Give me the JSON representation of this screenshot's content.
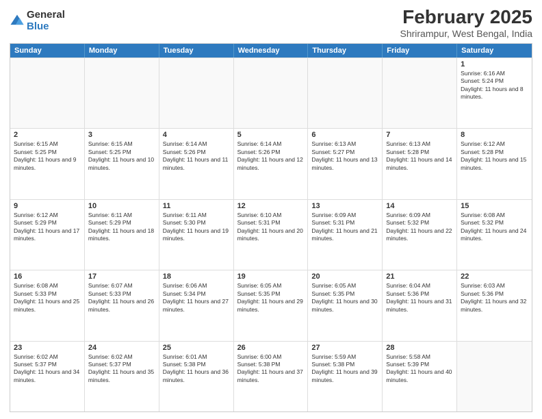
{
  "logo": {
    "general": "General",
    "blue": "Blue"
  },
  "header": {
    "title": "February 2025",
    "subtitle": "Shrirampur, West Bengal, India"
  },
  "weekdays": [
    "Sunday",
    "Monday",
    "Tuesday",
    "Wednesday",
    "Thursday",
    "Friday",
    "Saturday"
  ],
  "rows": [
    [
      {
        "day": "",
        "info": "",
        "empty": true
      },
      {
        "day": "",
        "info": "",
        "empty": true
      },
      {
        "day": "",
        "info": "",
        "empty": true
      },
      {
        "day": "",
        "info": "",
        "empty": true
      },
      {
        "day": "",
        "info": "",
        "empty": true
      },
      {
        "day": "",
        "info": "",
        "empty": true
      },
      {
        "day": "1",
        "info": "Sunrise: 6:16 AM\nSunset: 5:24 PM\nDaylight: 11 hours and 8 minutes.",
        "empty": false
      }
    ],
    [
      {
        "day": "2",
        "info": "Sunrise: 6:15 AM\nSunset: 5:25 PM\nDaylight: 11 hours and 9 minutes.",
        "empty": false
      },
      {
        "day": "3",
        "info": "Sunrise: 6:15 AM\nSunset: 5:25 PM\nDaylight: 11 hours and 10 minutes.",
        "empty": false
      },
      {
        "day": "4",
        "info": "Sunrise: 6:14 AM\nSunset: 5:26 PM\nDaylight: 11 hours and 11 minutes.",
        "empty": false
      },
      {
        "day": "5",
        "info": "Sunrise: 6:14 AM\nSunset: 5:26 PM\nDaylight: 11 hours and 12 minutes.",
        "empty": false
      },
      {
        "day": "6",
        "info": "Sunrise: 6:13 AM\nSunset: 5:27 PM\nDaylight: 11 hours and 13 minutes.",
        "empty": false
      },
      {
        "day": "7",
        "info": "Sunrise: 6:13 AM\nSunset: 5:28 PM\nDaylight: 11 hours and 14 minutes.",
        "empty": false
      },
      {
        "day": "8",
        "info": "Sunrise: 6:12 AM\nSunset: 5:28 PM\nDaylight: 11 hours and 15 minutes.",
        "empty": false
      }
    ],
    [
      {
        "day": "9",
        "info": "Sunrise: 6:12 AM\nSunset: 5:29 PM\nDaylight: 11 hours and 17 minutes.",
        "empty": false
      },
      {
        "day": "10",
        "info": "Sunrise: 6:11 AM\nSunset: 5:29 PM\nDaylight: 11 hours and 18 minutes.",
        "empty": false
      },
      {
        "day": "11",
        "info": "Sunrise: 6:11 AM\nSunset: 5:30 PM\nDaylight: 11 hours and 19 minutes.",
        "empty": false
      },
      {
        "day": "12",
        "info": "Sunrise: 6:10 AM\nSunset: 5:31 PM\nDaylight: 11 hours and 20 minutes.",
        "empty": false
      },
      {
        "day": "13",
        "info": "Sunrise: 6:09 AM\nSunset: 5:31 PM\nDaylight: 11 hours and 21 minutes.",
        "empty": false
      },
      {
        "day": "14",
        "info": "Sunrise: 6:09 AM\nSunset: 5:32 PM\nDaylight: 11 hours and 22 minutes.",
        "empty": false
      },
      {
        "day": "15",
        "info": "Sunrise: 6:08 AM\nSunset: 5:32 PM\nDaylight: 11 hours and 24 minutes.",
        "empty": false
      }
    ],
    [
      {
        "day": "16",
        "info": "Sunrise: 6:08 AM\nSunset: 5:33 PM\nDaylight: 11 hours and 25 minutes.",
        "empty": false
      },
      {
        "day": "17",
        "info": "Sunrise: 6:07 AM\nSunset: 5:33 PM\nDaylight: 11 hours and 26 minutes.",
        "empty": false
      },
      {
        "day": "18",
        "info": "Sunrise: 6:06 AM\nSunset: 5:34 PM\nDaylight: 11 hours and 27 minutes.",
        "empty": false
      },
      {
        "day": "19",
        "info": "Sunrise: 6:05 AM\nSunset: 5:35 PM\nDaylight: 11 hours and 29 minutes.",
        "empty": false
      },
      {
        "day": "20",
        "info": "Sunrise: 6:05 AM\nSunset: 5:35 PM\nDaylight: 11 hours and 30 minutes.",
        "empty": false
      },
      {
        "day": "21",
        "info": "Sunrise: 6:04 AM\nSunset: 5:36 PM\nDaylight: 11 hours and 31 minutes.",
        "empty": false
      },
      {
        "day": "22",
        "info": "Sunrise: 6:03 AM\nSunset: 5:36 PM\nDaylight: 11 hours and 32 minutes.",
        "empty": false
      }
    ],
    [
      {
        "day": "23",
        "info": "Sunrise: 6:02 AM\nSunset: 5:37 PM\nDaylight: 11 hours and 34 minutes.",
        "empty": false
      },
      {
        "day": "24",
        "info": "Sunrise: 6:02 AM\nSunset: 5:37 PM\nDaylight: 11 hours and 35 minutes.",
        "empty": false
      },
      {
        "day": "25",
        "info": "Sunrise: 6:01 AM\nSunset: 5:38 PM\nDaylight: 11 hours and 36 minutes.",
        "empty": false
      },
      {
        "day": "26",
        "info": "Sunrise: 6:00 AM\nSunset: 5:38 PM\nDaylight: 11 hours and 37 minutes.",
        "empty": false
      },
      {
        "day": "27",
        "info": "Sunrise: 5:59 AM\nSunset: 5:38 PM\nDaylight: 11 hours and 39 minutes.",
        "empty": false
      },
      {
        "day": "28",
        "info": "Sunrise: 5:58 AM\nSunset: 5:39 PM\nDaylight: 11 hours and 40 minutes.",
        "empty": false
      },
      {
        "day": "",
        "info": "",
        "empty": true
      }
    ]
  ]
}
